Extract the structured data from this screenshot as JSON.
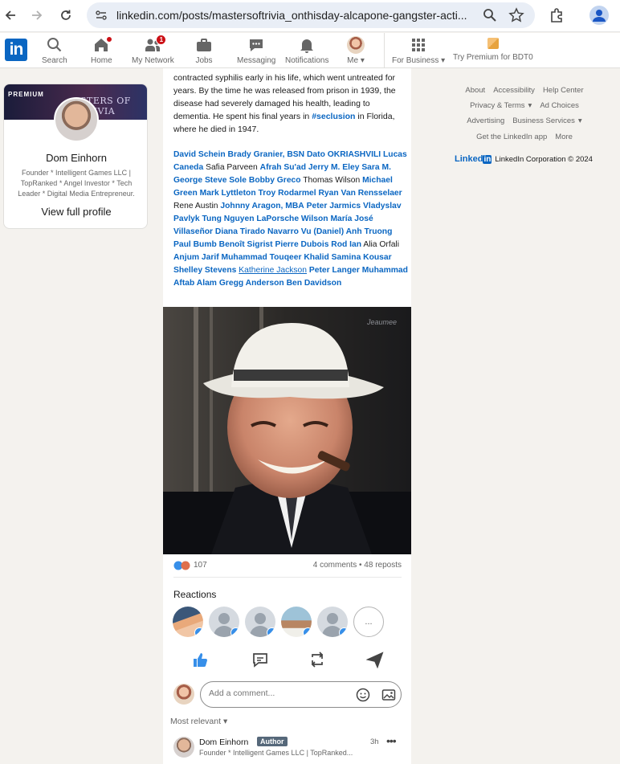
{
  "browser": {
    "url": "linkedin.com/posts/mastersoftrivia_onthisday-alcapone-gangster-acti..."
  },
  "nav": {
    "logo": "in",
    "items": [
      {
        "label": "Search",
        "icon": "search-icon"
      },
      {
        "label": "Home",
        "icon": "home-icon"
      },
      {
        "label": "My Network",
        "icon": "people-icon",
        "badge": "1"
      },
      {
        "label": "Jobs",
        "icon": "briefcase-icon"
      },
      {
        "label": "Messaging",
        "icon": "chat-icon"
      },
      {
        "label": "Notifications",
        "icon": "bell-icon"
      },
      {
        "label": "Me",
        "icon": "avatar"
      },
      {
        "label": "For Business",
        "icon": "grid-icon"
      }
    ],
    "premium": "Try Premium for BDT0"
  },
  "profile": {
    "banner_label": "PREMIUM",
    "banner_title": "STERS OF TRIVIA",
    "name": "Dom Einhorn",
    "headline": "Founder * Intelligent Games LLC | TopRanked * Angel Investor * Tech Leader * Digital Media Entrepreneur.",
    "view_profile": "View full profile"
  },
  "post": {
    "text_before": "contracted syphilis early in his life, which went untreated for years. By the time he was released from prison in 1939, the disease had severely damaged his health, leading to dementia. He spent his final years in ",
    "hashtag": "#seclusion",
    "text_after": " in Florida, where he died in 1947.",
    "mentions": [
      {
        "t": "David Schein",
        "l": true
      },
      {
        "t": "Brady Granier, BSN",
        "l": true
      },
      {
        "t": "Dato OKRIASHVILI",
        "l": true
      },
      {
        "t": "Lucas Caneda",
        "l": true
      },
      {
        "t": "Safia Parveen",
        "l": false
      },
      {
        "t": "Afrah Su'ad",
        "l": true
      },
      {
        "t": "Jerry M. Eley",
        "l": true
      },
      {
        "t": "Sara M. George",
        "l": true
      },
      {
        "t": "Steve Sole",
        "l": true
      },
      {
        "t": "Bobby Greco",
        "l": true
      },
      {
        "t": "Thomas Wilson",
        "l": false
      },
      {
        "t": "Michael Green",
        "l": true
      },
      {
        "t": "Mark Lyttleton",
        "l": true
      },
      {
        "t": "Troy Rodarmel",
        "l": true
      },
      {
        "t": "Ryan Van Rensselaer",
        "l": true
      },
      {
        "t": "Rene Austin",
        "l": false
      },
      {
        "t": "Johnny Aragon, MBA",
        "l": true
      },
      {
        "t": "Peter Jarmics",
        "l": true
      },
      {
        "t": "Vladyslav Pavlyk",
        "l": true
      },
      {
        "t": "Tung Nguyen",
        "l": true
      },
      {
        "t": "LaPorsche Wilson",
        "l": true
      },
      {
        "t": "María José Villaseñor",
        "l": true
      },
      {
        "t": "Diana Tirado Navarro",
        "l": true
      },
      {
        "t": "Vu (Daniel) Anh Truong",
        "l": true
      },
      {
        "t": "Paul Bumb",
        "l": true
      },
      {
        "t": "Benoît Sigrist",
        "l": true
      },
      {
        "t": "Pierre Dubois",
        "l": true
      },
      {
        "t": "Rod Ian",
        "l": true
      },
      {
        "t": "Alia Orfali",
        "l": false
      },
      {
        "t": "Anjum Jarif",
        "l": true
      },
      {
        "t": "Muhammad Touqeer",
        "l": true
      },
      {
        "t": "Khalid Samina",
        "l": true
      },
      {
        "t": "Kousar",
        "l": true
      },
      {
        "t": "Shelley Stevens",
        "l": true
      },
      {
        "t": "Katherine Jackson",
        "l": true,
        "u": true
      },
      {
        "t": "Peter Langer",
        "l": true
      },
      {
        "t": "Muhammad Aftab Alam",
        "l": true
      },
      {
        "t": "Gregg Anderson",
        "l": true
      },
      {
        "t": "Ben Davidson",
        "l": true
      }
    ],
    "photo_watermark": "Jeaumee",
    "reaction_count": "107",
    "comments_reposts": "4 comments • 48 reposts",
    "reactions_title": "Reactions",
    "more_reactors": "...",
    "comment_placeholder": "Add a comment...",
    "sort_label": "Most relevant",
    "comment": {
      "name": "Dom Einhorn",
      "badge": "Author",
      "time": "3h",
      "headline": "Founder * Intelligent Games LLC | TopRanked..."
    }
  },
  "footer": {
    "row1": [
      "About",
      "Accessibility",
      "Help Center"
    ],
    "row2": [
      "Privacy & Terms",
      "Ad Choices"
    ],
    "row3": [
      "Advertising",
      "Business Services"
    ],
    "row4": [
      "Get the LinkedIn app",
      "More"
    ],
    "brand_word": "Linked",
    "brand_in": "in",
    "copyright": "LinkedIn Corporation © 2024"
  },
  "colors": {
    "brand": "#0a66c2",
    "badge": "#cc1016",
    "like": "#378fe9"
  }
}
